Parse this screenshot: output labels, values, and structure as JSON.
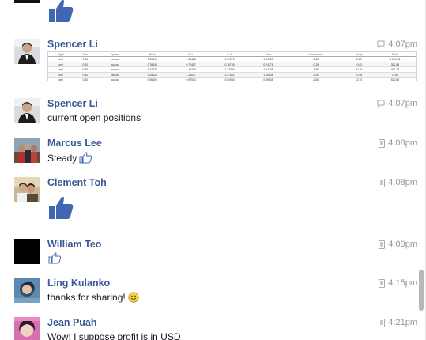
{
  "messages": [
    {
      "id": "m0",
      "name": "",
      "time": "",
      "device": "none",
      "text": "",
      "sticker": "like-big"
    },
    {
      "id": "m1",
      "name": "Spencer Li",
      "time": "4:07pm",
      "device": "chat",
      "attachment": {
        "headers": [
          "Type",
          "Size",
          "Symbol",
          "Price",
          "S / L",
          "T / P",
          "Price",
          "Commission",
          "Swap",
          "Profit"
        ],
        "rows": [
          [
            "sell",
            "0.25",
            "eurusd",
            "1.39319",
            "1.33428",
            "1.37275",
            "1.37623",
            "-1.62",
            "2.19",
            "1 294.81"
          ],
          [
            "sell",
            "0.20",
            "audusd",
            "0.76946",
            "0.77487",
            "0.76755",
            "0.74776",
            "-0.25",
            "-0.62",
            "301.89"
          ],
          [
            "sell",
            "0.30",
            "eurnzd",
            "1.42770",
            "1.41378",
            "1.37590",
            "1.41739",
            "-1.90",
            "-11.51",
            "401.72"
          ],
          [
            "buy",
            "0.40",
            "usdcad",
            "1.28425",
            "1.24007",
            "1.27851",
            "1.28298",
            "-2.00",
            "-0.96",
            "79.80"
          ],
          [
            "sell",
            "0.40",
            "audusd",
            "0.96062",
            "0.97514",
            "0.94940",
            "0.99845",
            "-2.60",
            "-2.40",
            "520.62"
          ]
        ]
      }
    },
    {
      "id": "m2",
      "name": "Spencer Li",
      "time": "4:07pm",
      "device": "chat",
      "text": "current open positions"
    },
    {
      "id": "m3",
      "name": "Marcus Lee",
      "time": "4:08pm",
      "device": "mobile",
      "text": "Steady"
    },
    {
      "id": "m4",
      "name": "Clement Toh",
      "time": "4:08pm",
      "device": "mobile",
      "text": ""
    },
    {
      "id": "m5",
      "name": "William Teo",
      "time": "4:09pm",
      "device": "mobile",
      "text": ""
    },
    {
      "id": "m6",
      "name": "Ling Kulanko",
      "time": "4:15pm",
      "device": "mobile",
      "text": "thanks for sharing!"
    },
    {
      "id": "m7",
      "name": "Jean Puah",
      "time": "4:21pm",
      "device": "mobile",
      "text": "Wow! I suppose profit is in USD"
    }
  ],
  "colors": {
    "name": "#3b5998",
    "meta": "#9197a3",
    "like_blue": "#4267b2"
  },
  "icons": {
    "chat": "chat-bubble-icon",
    "mobile": "mobile-phone-icon",
    "like": "thumbs-up-icon",
    "smiley": "smiley-emoji-icon"
  }
}
